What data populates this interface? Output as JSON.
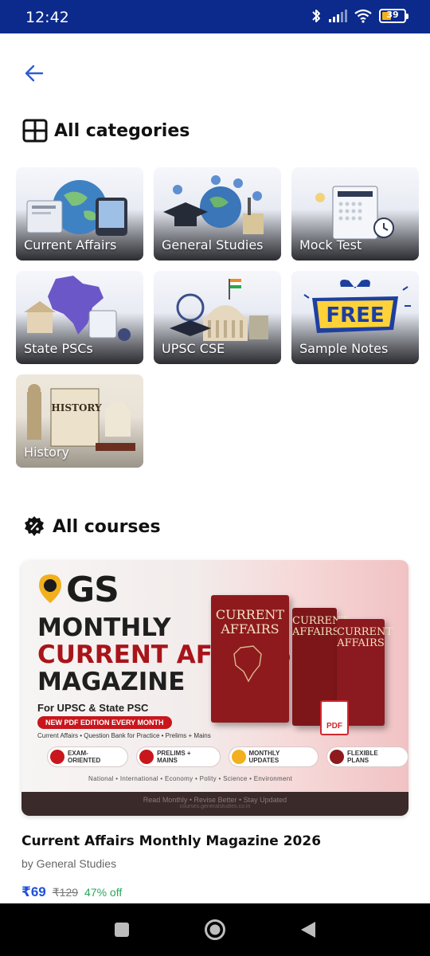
{
  "status_bar": {
    "time": "12:42",
    "battery_level": "39",
    "icons": [
      "bluetooth-icon",
      "signal-icon",
      "wifi-icon",
      "battery-icon"
    ],
    "background": "#0b2a8c"
  },
  "header": {
    "back_icon": "arrow-left-icon",
    "accent": "#2f5bd3"
  },
  "categories_section": {
    "title": "All categories",
    "icon": "grid-icon",
    "items": [
      {
        "label": "Current Affairs"
      },
      {
        "label": "General Studies"
      },
      {
        "label": "Mock Test"
      },
      {
        "label": "State PSCs"
      },
      {
        "label": "UPSC CSE"
      },
      {
        "label": "Sample Notes"
      },
      {
        "label": "History"
      }
    ]
  },
  "courses_section": {
    "title": "All courses",
    "icon": "badge-percent-icon"
  },
  "course": {
    "banner": {
      "brand": "GS",
      "line1": "MONTHLY",
      "line2": "CURRENT AFFAIRS",
      "line3": "MAGAZINE",
      "for_text": "For UPSC & State PSC",
      "pill": "NEW PDF EDITION EVERY MONTH",
      "small": "Current Affairs • Question Bank for Practice • Prelims + Mains",
      "features": [
        "EXAM-ORIENTED",
        "PRELIMS + MAINS",
        "MONTHLY UPDATES",
        "FLEXIBLE PLANS"
      ],
      "topics": "National  •  International  •  Economy  •  Polity  •  Science  •  Environment",
      "footer": "Read Monthly  •  Revise Better  •  Stay Updated",
      "footer_url": "courses.generalstudies.co.in",
      "book_title": "CURRENT AFFAIRS",
      "pdf_label": "PDF"
    },
    "title": "Current Affairs Monthly Magazine 2026",
    "author": "by General Studies",
    "price": "₹69",
    "mrp": "₹129",
    "discount": "47% off",
    "price_color": "#1e4fd8",
    "discount_color": "#28a85c"
  },
  "nav_bar": {
    "buttons": [
      "recents-square-icon",
      "home-circle-icon",
      "back-triangle-icon"
    ]
  }
}
